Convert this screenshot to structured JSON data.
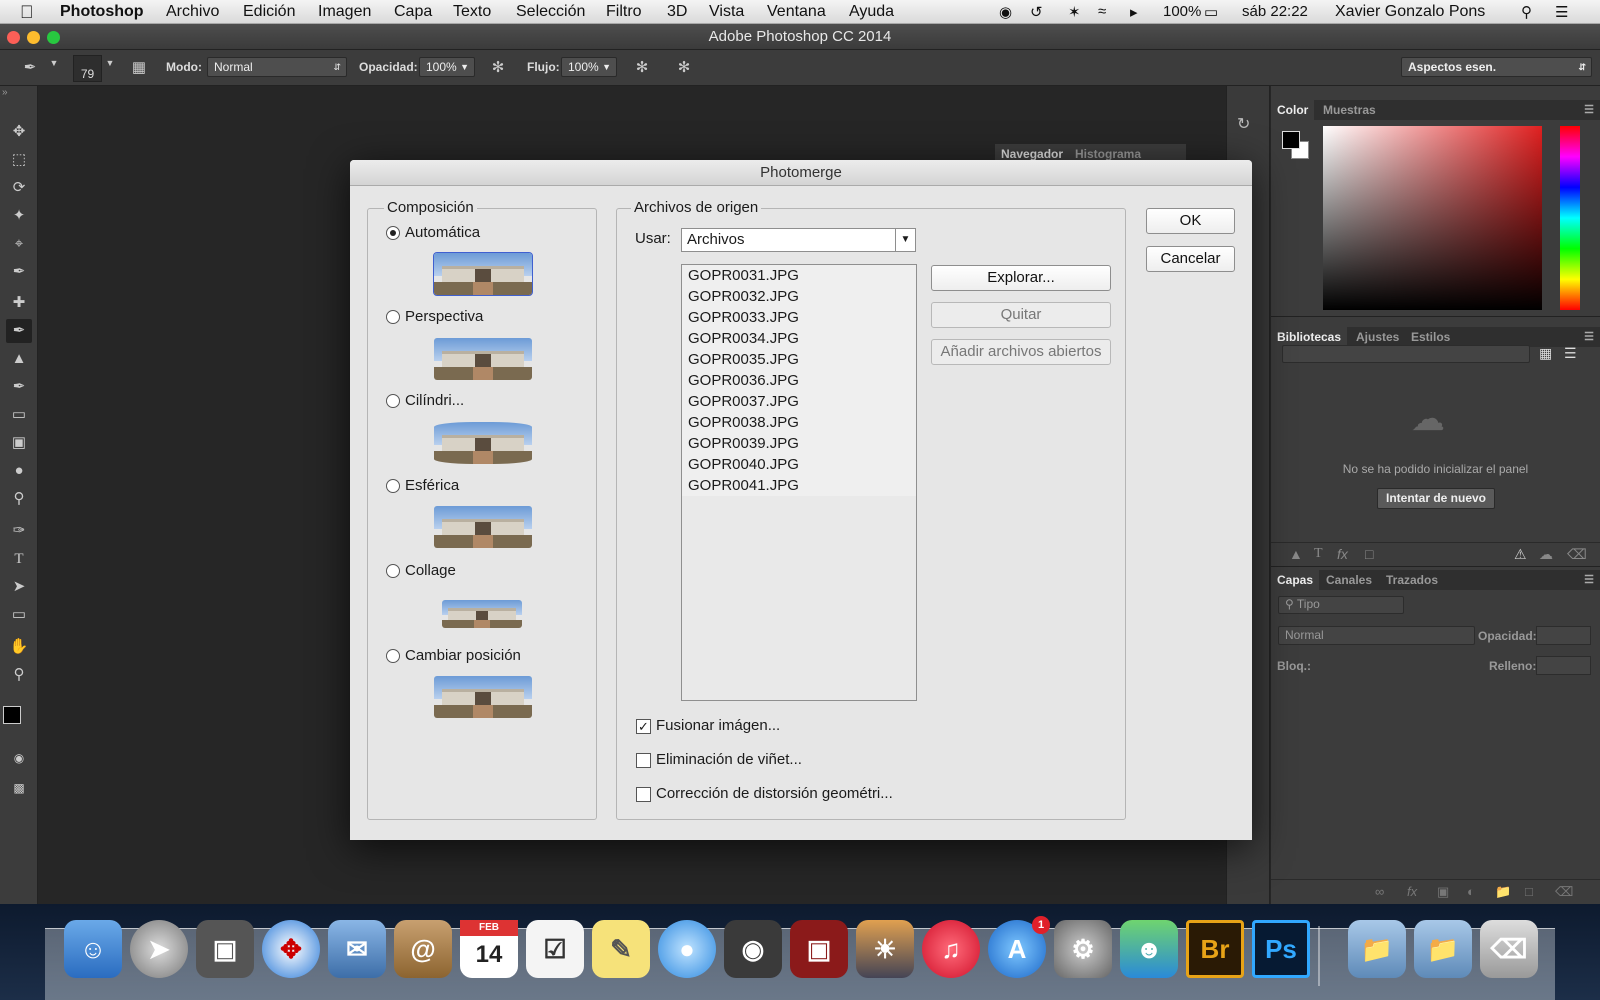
{
  "menubar": {
    "apple_icon": "apple-icon",
    "app_name": "Photoshop",
    "menus": [
      "Archivo",
      "Edición",
      "Imagen",
      "Capa",
      "Texto",
      "Selección",
      "Filtro",
      "3D",
      "Vista",
      "Ventana",
      "Ayuda"
    ],
    "battery": "100%",
    "clock": "sáb 22:22",
    "user": "Xavier Gonzalo Pons"
  },
  "window": {
    "title": "Adobe Photoshop CC 2014"
  },
  "options_bar": {
    "brush_size": "79",
    "mode_label": "Modo:",
    "mode_value": "Normal",
    "opacity_label": "Opacidad:",
    "opacity_value": "100%",
    "flow_label": "Flujo:",
    "flow_value": "100%",
    "workspace_value": "Aspectos esen."
  },
  "background_tabs": {
    "navigator": "Navegador",
    "histogram": "Histograma"
  },
  "color_panel": {
    "tabs": [
      "Color",
      "Muestras"
    ]
  },
  "libraries_panel": {
    "tabs": [
      "Bibliotecas",
      "Ajustes",
      "Estilos"
    ],
    "error": "No se ha podido inicializar el panel",
    "retry": "Intentar de nuevo"
  },
  "layers_panel": {
    "tabs": [
      "Capas",
      "Canales",
      "Trazados"
    ],
    "filter": "Tipo",
    "blend": "Normal",
    "opacity_label": "Opacidad:",
    "lock_label": "Bloq.:",
    "fill_label": "Relleno:"
  },
  "dialog": {
    "title": "Photomerge",
    "composition_legend": "Composición",
    "layouts": [
      {
        "label": "Automática",
        "checked": true
      },
      {
        "label": "Perspectiva",
        "checked": false
      },
      {
        "label": "Cilíndri...",
        "checked": false
      },
      {
        "label": "Esférica",
        "checked": false
      },
      {
        "label": "Collage",
        "checked": false
      },
      {
        "label": "Cambiar posición",
        "checked": false
      }
    ],
    "source_legend": "Archivos de origen",
    "use_label": "Usar:",
    "use_value": "Archivos",
    "files": [
      "GOPR0031.JPG",
      "GOPR0032.JPG",
      "GOPR0033.JPG",
      "GOPR0034.JPG",
      "GOPR0035.JPG",
      "GOPR0036.JPG",
      "GOPR0037.JPG",
      "GOPR0038.JPG",
      "GOPR0039.JPG",
      "GOPR0040.JPG",
      "GOPR0041.JPG"
    ],
    "browse": "Explorar...",
    "remove": "Quitar",
    "add_open": "Añadir archivos abiertos",
    "ok": "OK",
    "cancel": "Cancelar",
    "options": [
      {
        "label": "Fusionar imágen...",
        "checked": true
      },
      {
        "label": "Eliminación de viñet...",
        "checked": false
      },
      {
        "label": "Corrección de distorsión geométri...",
        "checked": false
      }
    ]
  },
  "dock": {
    "badge_app_store": "1",
    "calendar_month": "FEB",
    "calendar_day": "14",
    "bridge_label": "Br",
    "photoshop_label": "Ps"
  }
}
